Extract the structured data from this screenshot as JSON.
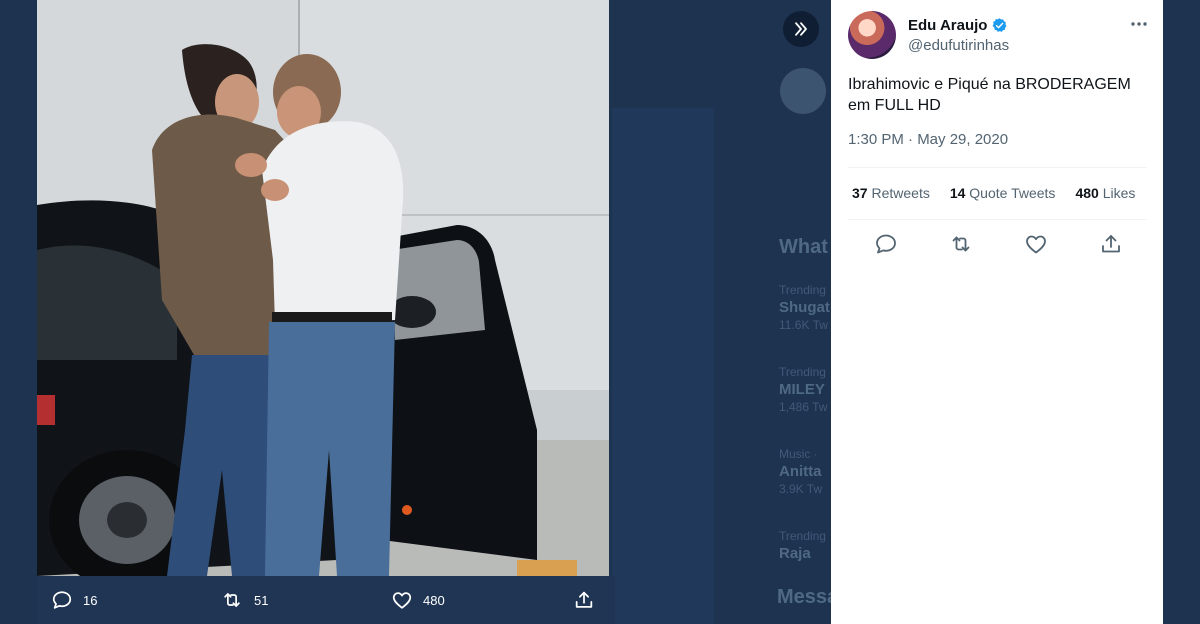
{
  "background": {
    "sidebar_heading": "What",
    "trends": [
      {
        "context": "Trending",
        "name": "Shugat",
        "count": "11.6K Tw"
      },
      {
        "context": "Trending",
        "name": "MILEY",
        "count": "1,486 Tw"
      },
      {
        "context": "Music ·",
        "name": "Anitta",
        "count": "3.9K Tw"
      },
      {
        "context": "Trending",
        "name": "Raja",
        "count": ""
      }
    ],
    "messages_label": "Messa"
  },
  "media_bar": {
    "reply_count": "16",
    "retweet_count": "51",
    "like_count": "480"
  },
  "tweet": {
    "author_name": "Edu Araujo",
    "author_handle": "@edufutirinhas",
    "text_line1": "Ibrahimovic e Piqué na BRODERAGEM",
    "text_line2": "em FULL HD",
    "timestamp": "1:30 PM · May 29, 2020",
    "stats": {
      "retweets_count": "37",
      "retweets_label": "Retweets",
      "quote_count": "14",
      "quote_label": "Quote Tweets",
      "likes_count": "480",
      "likes_label": "Likes"
    }
  },
  "icons": {
    "reply": "reply-icon",
    "retweet": "retweet-icon",
    "like": "like-icon",
    "share": "share-icon",
    "expand": "expand-chevrons-icon",
    "more": "more-icon",
    "verified": "verified-icon"
  },
  "colors": {
    "backdrop": "#1d3350",
    "verified_blue": "#1d9bf0",
    "text_primary": "#0f1419",
    "text_secondary": "#536471"
  }
}
